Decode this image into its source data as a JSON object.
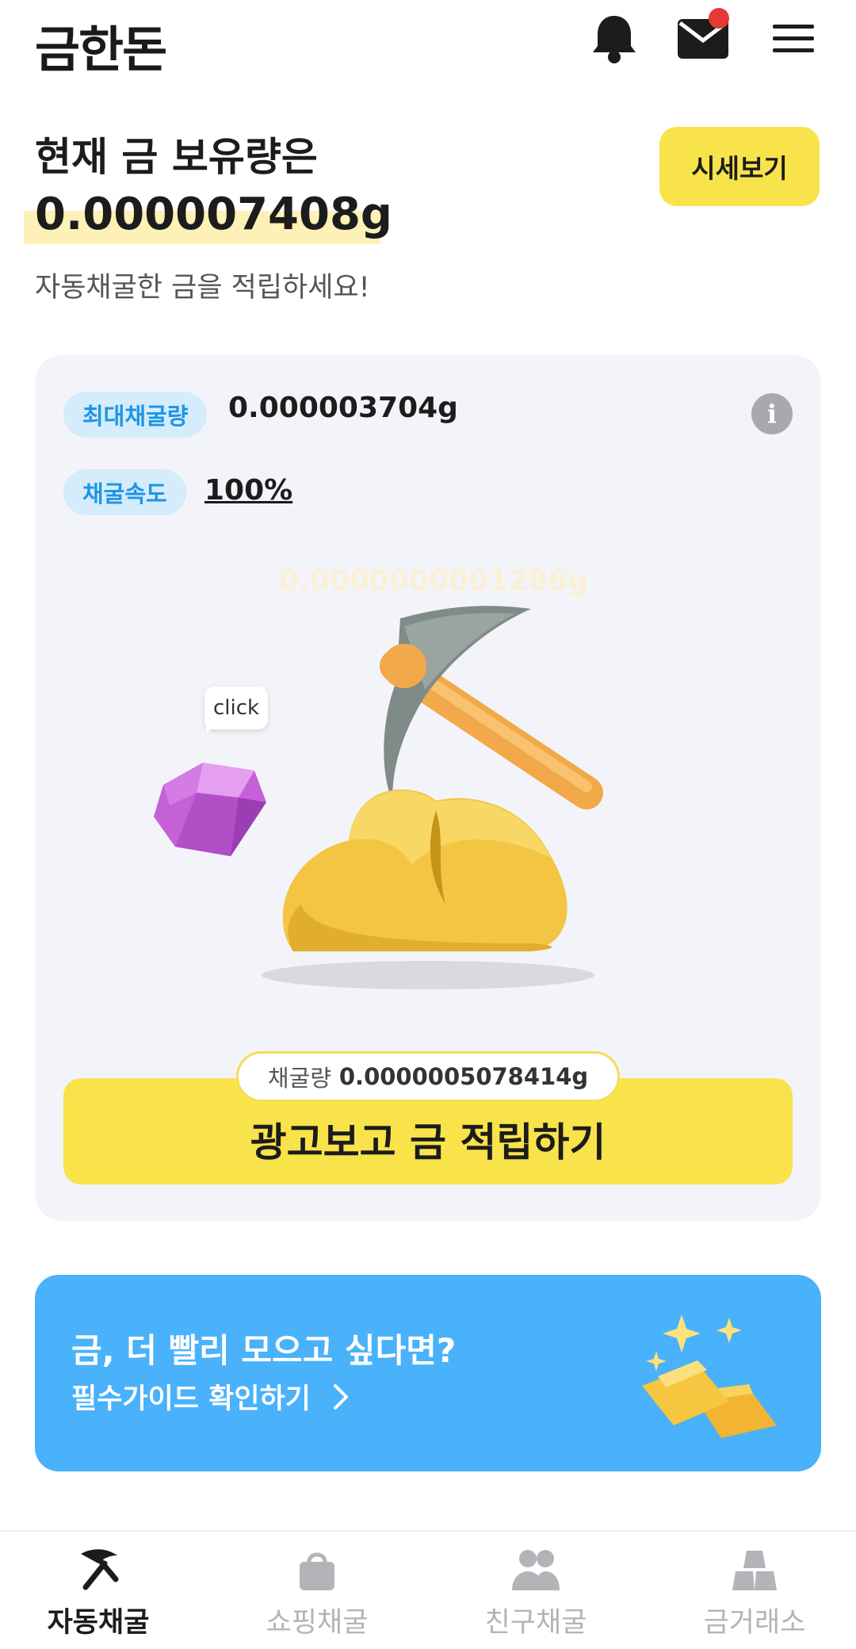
{
  "header": {
    "logo": "금한돈",
    "icons": [
      "bell-icon",
      "mail-icon",
      "menu-icon"
    ],
    "has_unread_mail": true
  },
  "holdings": {
    "label": "현재 금 보유량은",
    "value": "0.000007408g",
    "subtitle": "자동채굴한 금을 적립하세요!",
    "price_button": "시세보기"
  },
  "mining": {
    "max_label": "최대채굴량",
    "max_value": "0.000003704g",
    "speed_label": "채굴속도",
    "speed_value": "100%",
    "live_counter": "0.0000000001286g",
    "click_hint": "click",
    "amount_label": "채굴량",
    "amount_value": "0.0000005078414g",
    "action_button": "광고보고 금 적립하기"
  },
  "banner": {
    "title": "금, 더 빨리 모으고 싶다면?",
    "link": "필수가이드 확인하기"
  },
  "nav": {
    "items": [
      {
        "label": "자동채굴",
        "icon": "pickaxe-icon",
        "active": true
      },
      {
        "label": "쇼핑채굴",
        "icon": "shopping-bag-icon",
        "active": false
      },
      {
        "label": "친구채굴",
        "icon": "friends-icon",
        "active": false
      },
      {
        "label": "금거래소",
        "icon": "gold-exchange-icon",
        "active": false
      }
    ]
  },
  "colors": {
    "accent_yellow": "#f9e34a",
    "banner_blue": "#4ab1fb",
    "chip_blue": "#1e95e6",
    "card_bg": "#f3f4f9"
  }
}
